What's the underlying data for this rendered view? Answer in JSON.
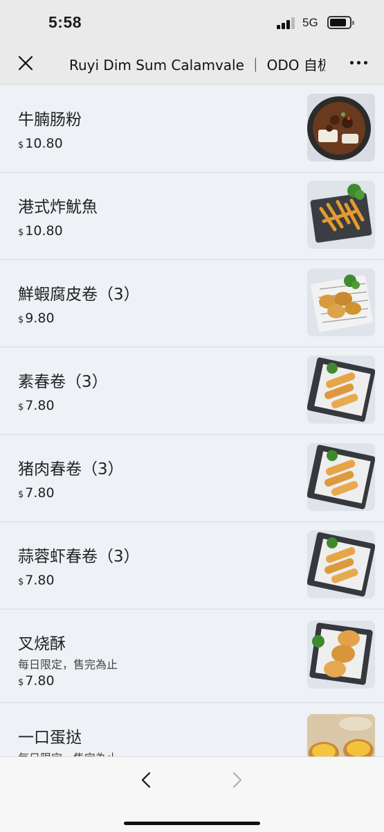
{
  "status_bar": {
    "time": "5:58",
    "network": "5G"
  },
  "nav": {
    "title": "Ruyi Dim Sum Calamvale ｜ ODO 自极"
  },
  "menu": {
    "currency_symbol": "$",
    "items": [
      {
        "name": "牛腩肠粉",
        "price": "10.80",
        "image": "beef-brisket-rice-roll",
        "note": ""
      },
      {
        "name": "港式炸魷魚",
        "price": "10.80",
        "image": "fried-calamari",
        "note": ""
      },
      {
        "name": "鮮蝦腐皮卷（3）",
        "price": "9.80",
        "image": "shrimp-beancurd-roll",
        "note": ""
      },
      {
        "name": "素春卷（3）",
        "price": "7.80",
        "image": "spring-roll",
        "note": ""
      },
      {
        "name": "猪肉春卷（3）",
        "price": "7.80",
        "image": "spring-roll",
        "note": ""
      },
      {
        "name": "蒜蓉虾春卷（3）",
        "price": "7.80",
        "image": "spring-roll",
        "note": ""
      },
      {
        "name": "叉烧酥",
        "price": "7.80",
        "image": "bbq-pork-pastry",
        "note": "每日限定，售完為止"
      },
      {
        "name": "一口蛋挞",
        "price": "",
        "image": "egg-tart",
        "note": "每日限定，售完為止"
      }
    ]
  },
  "colors": {
    "background": "#eef1f5",
    "bars": "#eaeaea",
    "text": "#1d1d1f"
  },
  "icons": {
    "close": "close-icon",
    "more": "more-dots-icon",
    "back": "chevron-left-icon",
    "forward": "chevron-right-icon"
  }
}
